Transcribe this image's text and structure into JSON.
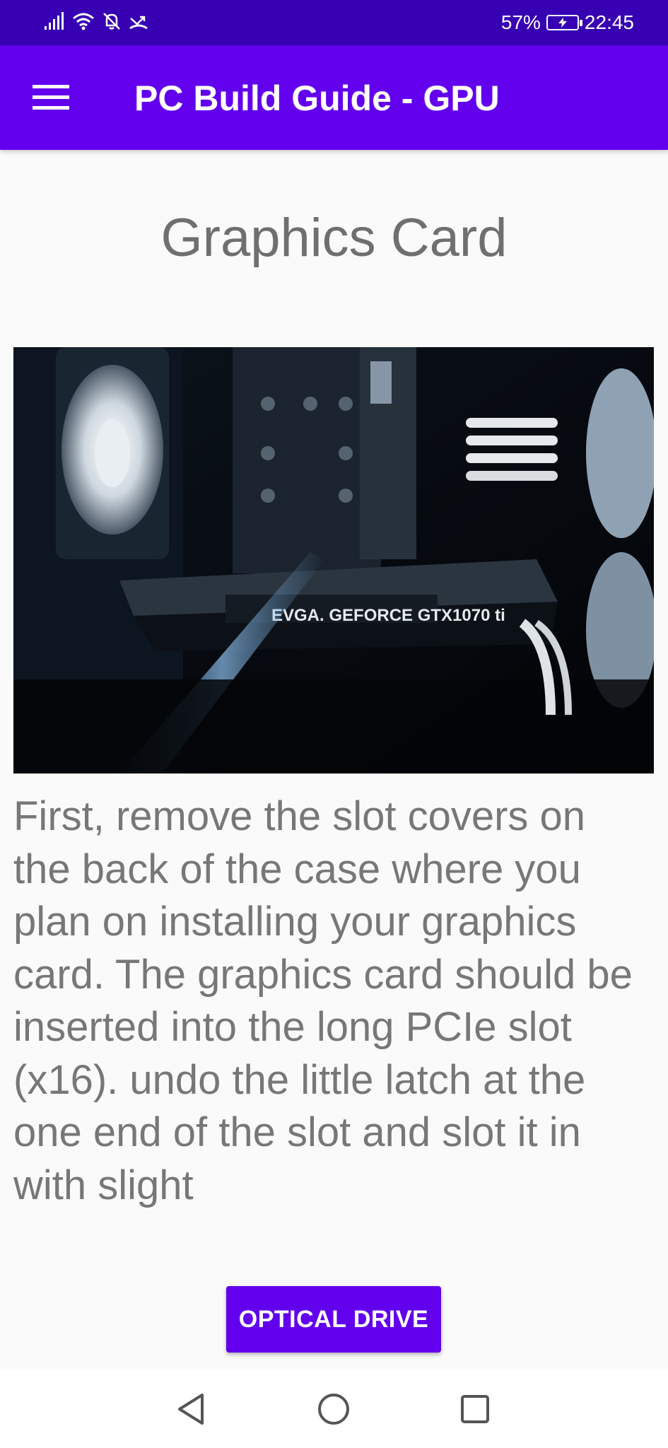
{
  "status_bar": {
    "battery_percent": "57%",
    "time": "22:45",
    "icons": [
      "signal-icon",
      "wifi-icon",
      "notifications-off-icon",
      "missed-call-icon",
      "battery-charging-icon"
    ]
  },
  "app_bar": {
    "title": "PC Build Guide - GPU",
    "menu_icon": "hamburger-menu-icon"
  },
  "content": {
    "heading": "Graphics Card",
    "image_label": "EVGA. GEFORCE GTX1070 ti",
    "paragraph": "First, remove the slot covers on the back of the case where you plan on installing your graphics card. The graphics card should be inserted into the long PCIe slot (x16). undo the little latch at the one end of the slot and slot it in with slight"
  },
  "next_button": {
    "label": "OPTICAL DRIVE"
  },
  "nav_bar": {
    "icons": [
      "back-triangle-icon",
      "home-circle-icon",
      "recents-square-icon"
    ]
  },
  "colors": {
    "status_bar": "#3700b3",
    "app_bar": "#6200ee",
    "button": "#6200ee",
    "background": "#fafafa",
    "text": "#777777"
  }
}
